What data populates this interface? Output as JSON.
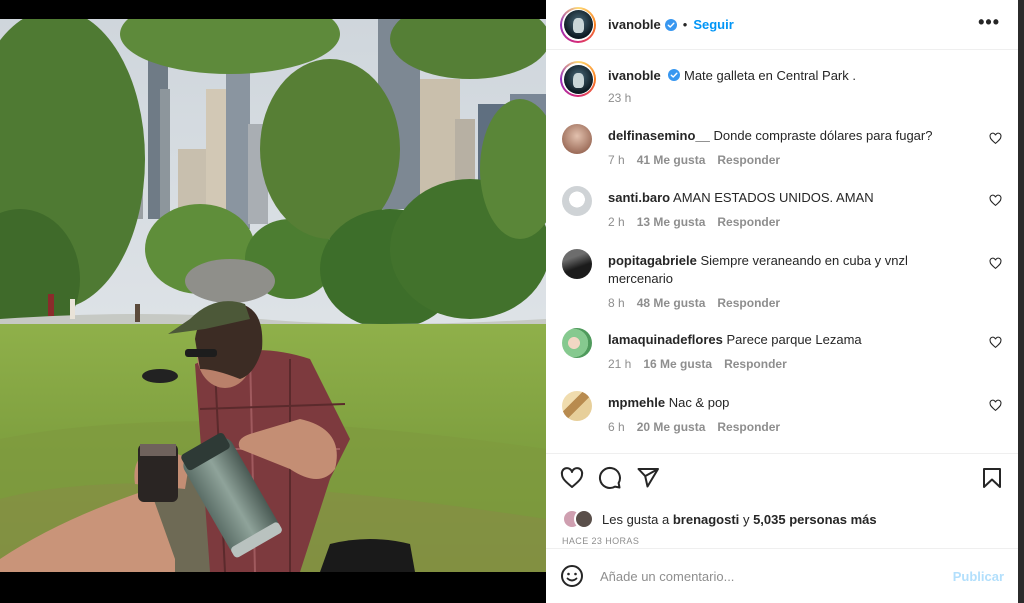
{
  "post": {
    "author": "ivanoble",
    "follow_label": "Seguir",
    "dot": "•",
    "more_label": "•••",
    "caption_text": "Mate galleta en Central Park .",
    "caption_time": "23 h"
  },
  "comments": [
    {
      "user": "delfinasemino__",
      "text": "Donde compraste dólares para fugar?",
      "time": "7 h",
      "likes": "41 Me gusta",
      "reply": "Responder",
      "avatar_color": "#b88a74"
    },
    {
      "user": "santi.baro",
      "text": "AMAN ESTADOS UNIDOS. AMAN",
      "time": "2 h",
      "likes": "13 Me gusta",
      "reply": "Responder",
      "avatar_color": "#cfd3d6"
    },
    {
      "user": "popitagabriele",
      "text": "Siempre veraneando en cuba y vnzl mercenario",
      "time": "8 h",
      "likes": "48 Me gusta",
      "reply": "Responder",
      "avatar_color": "#2e2e2e"
    },
    {
      "user": "lamaquinadeflores",
      "text": "Parece parque Lezama",
      "time": "21 h",
      "likes": "16 Me gusta",
      "reply": "Responder",
      "avatar_color": "#7fc48a"
    },
    {
      "user": "mpmehle",
      "text": "Nac & pop",
      "time": "6 h",
      "likes": "20 Me gusta",
      "reply": "Responder",
      "avatar_color": "#d9b77a"
    }
  ],
  "likes": {
    "prefix": "Les gusta a",
    "first_user": "brenagosti",
    "connector": "y",
    "others": "5,035 personas más"
  },
  "time_ago": "HACE 23 HORAS",
  "composer": {
    "placeholder": "Añade un comentario...",
    "publish_label": "Publicar"
  },
  "colors": {
    "link_blue": "#0095f6",
    "publish_disabled": "#b2dffc",
    "muted": "#8e8e8e",
    "verified": "#3897f0"
  },
  "icons": [
    "verified-badge-icon",
    "more-options-icon",
    "heart-icon",
    "comment-icon",
    "share-icon",
    "bookmark-icon",
    "emoji-icon"
  ]
}
